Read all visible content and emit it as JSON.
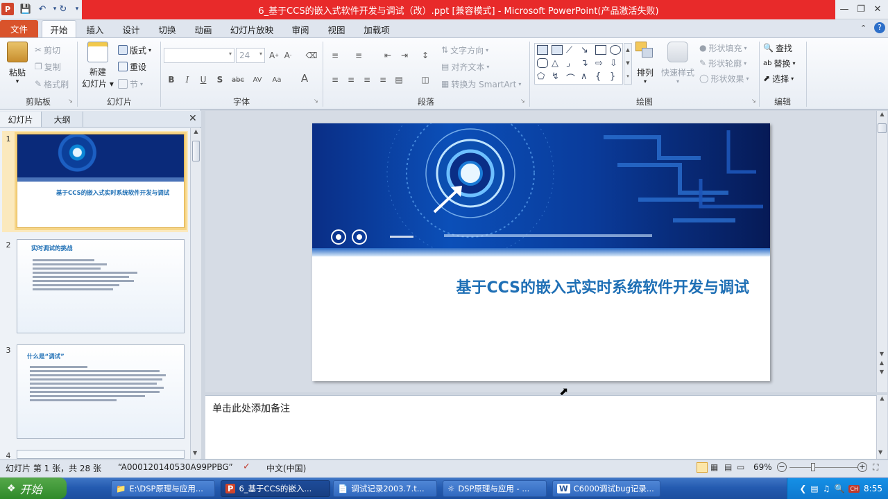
{
  "window": {
    "title": "6_基于CCS的嵌入式软件开发与调试（改）.ppt [兼容模式] - Microsoft PowerPoint(产品激活失败)"
  },
  "quick_access": {
    "app_icon": "powerpoint-icon",
    "save_icon": "save-icon",
    "undo_icon": "undo-icon",
    "redo_icon": "redo-icon"
  },
  "tabs": [
    {
      "label": "文件"
    },
    {
      "label": "开始"
    },
    {
      "label": "插入"
    },
    {
      "label": "设计"
    },
    {
      "label": "切换"
    },
    {
      "label": "动画"
    },
    {
      "label": "幻灯片放映"
    },
    {
      "label": "审阅"
    },
    {
      "label": "视图"
    },
    {
      "label": "加载项"
    }
  ],
  "ribbon": {
    "clipboard": {
      "paste": "粘贴",
      "cut": "剪切",
      "copy": "复制",
      "format_painter": "格式刷",
      "group": "剪贴板"
    },
    "slides": {
      "new_slide_1": "新建",
      "new_slide_2": "幻灯片",
      "layout": "版式",
      "reset": "重设",
      "section": "节",
      "group": "幻灯片"
    },
    "font": {
      "size": "24",
      "group": "字体"
    },
    "paragraph": {
      "text_direction": "文字方向",
      "align_text": "对齐文本",
      "smartart": "转换为 SmartArt",
      "group": "段落"
    },
    "drawing": {
      "arrange": "排列",
      "quick_styles": "快速样式",
      "shape_fill": "形状填充",
      "shape_outline": "形状轮廓",
      "shape_effects": "形状效果",
      "group": "绘图"
    },
    "editing": {
      "find": "查找",
      "replace": "替换",
      "select": "选择",
      "group": "编辑"
    }
  },
  "left_panel": {
    "tab_slides": "幻灯片",
    "tab_outline": "大纲",
    "slides": [
      {
        "num": "1",
        "title": "基于CCS的嵌入式实时系统软件开发与调试"
      },
      {
        "num": "2",
        "title": "实时调试的挑战"
      },
      {
        "num": "3",
        "title": "什么是“调试”"
      },
      {
        "num": "4",
        "title": ""
      }
    ]
  },
  "slide": {
    "title": "基于CCS的嵌入式实时系统软件开发与调试"
  },
  "notes": {
    "placeholder": "单击此处添加备注"
  },
  "status": {
    "slide_info": "幻灯片 第 1 张，共 28 张",
    "theme": "“A000120140530A99PPBG”",
    "language": "中文(中国)",
    "zoom": "69%",
    "zoom_level": 0.69
  },
  "taskbar": {
    "start": "开始",
    "tasks": [
      {
        "label": "E:\\DSP原理与应用..."
      },
      {
        "label": "6_基于CCS的嵌入..."
      },
      {
        "label": "调试记录2003.7.t..."
      },
      {
        "label": "DSP原理与应用 - ..."
      },
      {
        "label": "C6000调试bug记录..."
      }
    ],
    "clock": "8:55"
  },
  "colors": {
    "accent_red": "#e82a2a",
    "file_tab": "#d9532b",
    "slide_title": "#1e6fb5"
  }
}
